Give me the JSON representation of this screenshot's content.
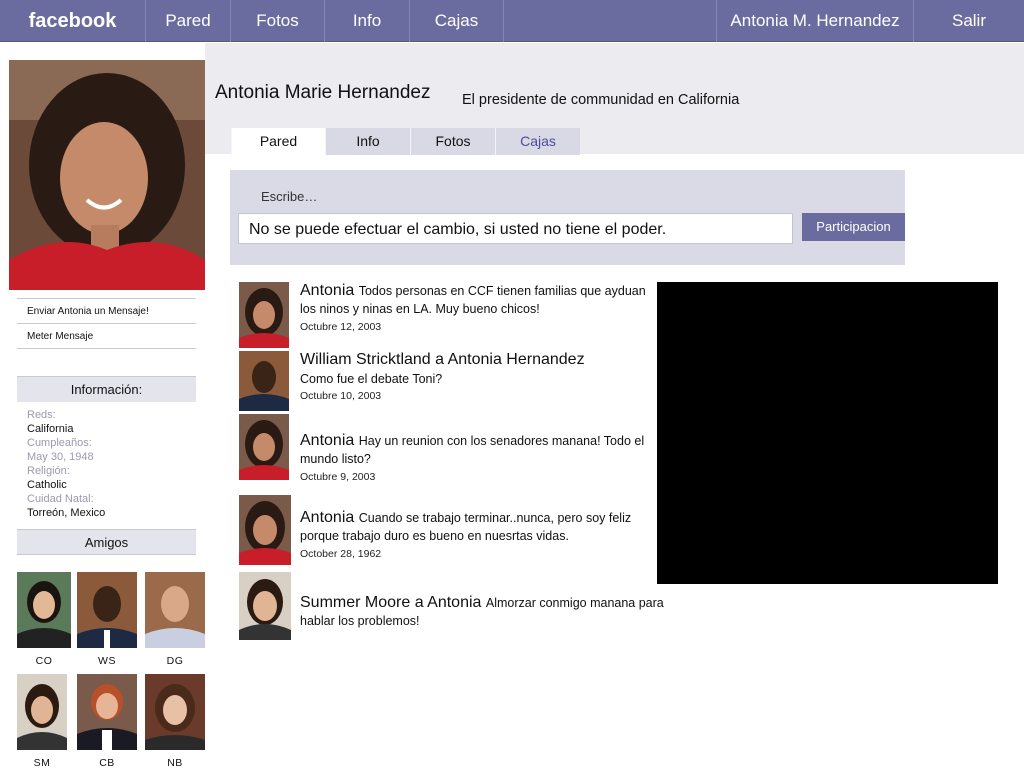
{
  "topbar": {
    "brand": "facebook",
    "nav": [
      "Pared",
      "Fotos",
      "Info",
      "Cajas"
    ],
    "user": "Antonia M. Hernandez",
    "logout": "Salir"
  },
  "profile": {
    "name": "Antonia Marie Hernandez",
    "title": "El presidente de communidad en California",
    "tabs": [
      "Pared",
      "Info",
      "Fotos",
      "Cajas"
    ]
  },
  "sidebar": {
    "links": [
      "Enviar Antonia un Mensaje!",
      "Meter Mensaje"
    ],
    "info_header": "Información:",
    "info": [
      {
        "label": "Reds:",
        "value": "California"
      },
      {
        "label": "Cumpleaños:",
        "value": "May 30, 1948"
      },
      {
        "label": "Religión:",
        "value": "Catholic"
      },
      {
        "label": "Cuidad Natal:",
        "value": "Torreón, Mexico"
      }
    ],
    "friends_header": "Amigos",
    "friends": [
      "CO",
      "WS",
      "DG",
      "SM",
      "CB",
      "NB"
    ]
  },
  "composer": {
    "prompt": "Escribe…",
    "value": "No se puede efectuar el cambio, si usted no tiene el poder.",
    "button": "Participacion"
  },
  "feed": [
    {
      "author": "Antonia",
      "message": "Todos personas en CCF tienen familias que ayduan los ninos y ninas en LA. Muy bueno chicos!",
      "date": "Octubre 12, 2003"
    },
    {
      "author": "William Stricktland a Antonia Hernandez",
      "message": "Como fue el debate Toni?",
      "date": "Octubre 10, 2003"
    },
    {
      "author": "Antonia",
      "message": "Hay un reunion con los senadores manana! Todo el mundo listo?",
      "date": "Octubre 9, 2003"
    },
    {
      "author": "Antonia",
      "message": "Cuando se trabajo terminar..nunca, pero soy feliz porque trabajo duro es bueno en nuesrtas vidas.",
      "date": "October 28, 1962"
    },
    {
      "author": "Summer Moore a Antonia",
      "message": "Almorzar conmigo manana para hablar los problemos!",
      "date": ""
    }
  ],
  "colors": {
    "topbar": "#6a6c9f",
    "band": "#ebebf0",
    "composer": "#d9dae6",
    "video": "#000000"
  }
}
